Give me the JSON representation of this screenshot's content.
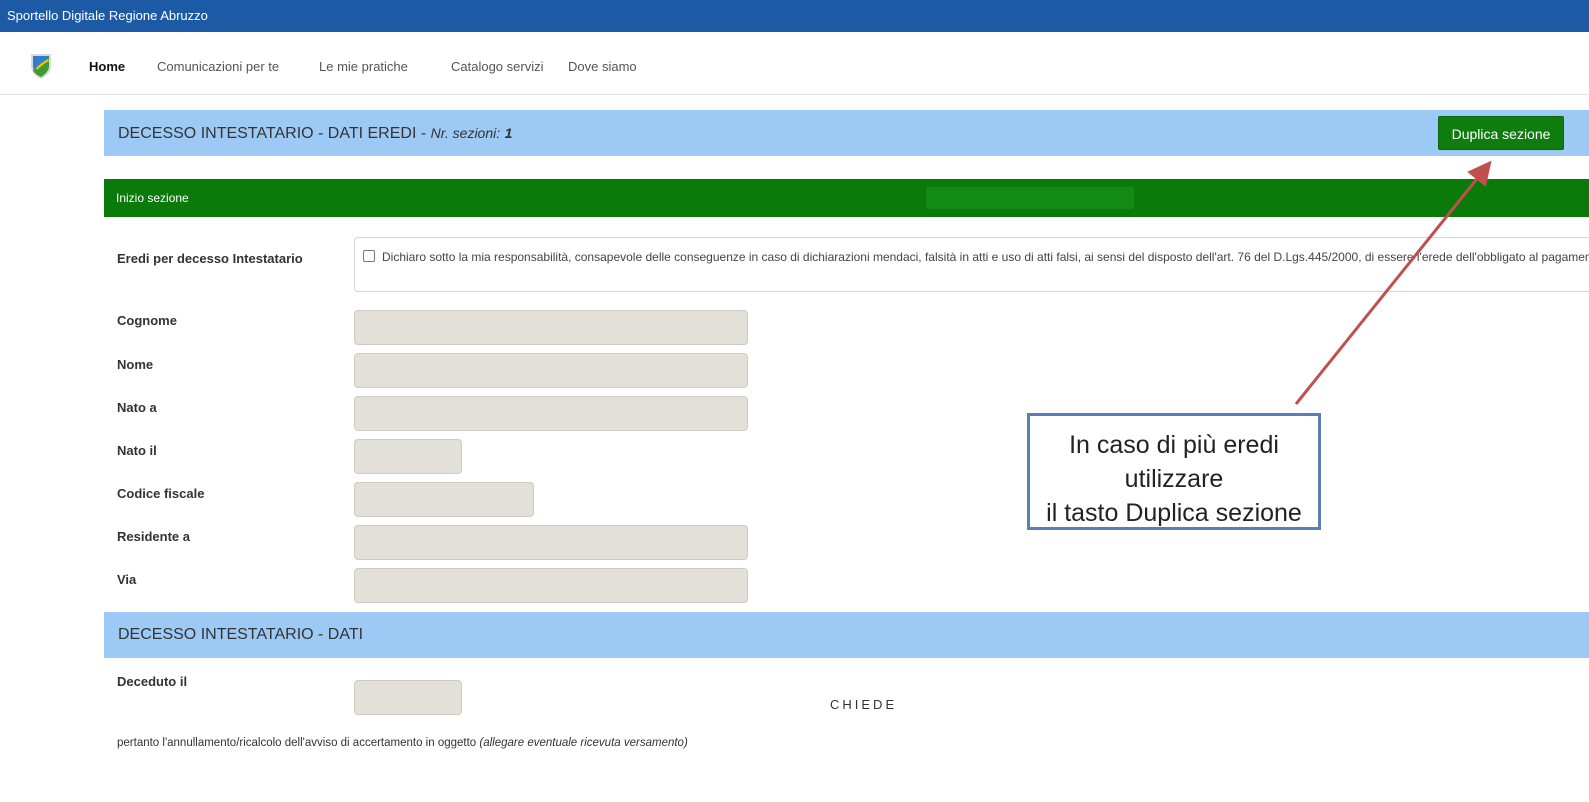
{
  "topbar": {
    "title": "Sportello Digitale Regione Abruzzo"
  },
  "nav": {
    "items": [
      {
        "label": "Home",
        "active": true
      },
      {
        "label": "Comunicazioni per te"
      },
      {
        "label": "Le mie pratiche"
      },
      {
        "label": "Catalogo servizi"
      },
      {
        "label": "Dove siamo"
      }
    ]
  },
  "section_heirs": {
    "title": "DECESSO INTESTATARIO - DATI EREDI -",
    "subtitle": "Nr. sezioni:",
    "count": "1",
    "duplicate_button": "Duplica sezione",
    "start_label": "Inizio sezione"
  },
  "form": {
    "heirs_label": "Eredi per decesso Intestatario",
    "declaration": "Dichiaro sotto la mia responsabilità, consapevole delle conseguenze in caso di dichiarazioni mendaci, falsità in atti e uso di atti falsi, ai sensi del disposto dell'art. 76 del D.Lgs.445/2000, di essere l'erede dell'obbligato al pagamento",
    "fields": [
      {
        "label": "Cognome"
      },
      {
        "label": "Nome"
      },
      {
        "label": "Nato a"
      },
      {
        "label": "Nato il"
      },
      {
        "label": "Codice fiscale"
      },
      {
        "label": "Residente a"
      },
      {
        "label": "Via"
      }
    ]
  },
  "section_data": {
    "title": "DECESSO INTESTATARIO - DATI",
    "deceased_label": "Deceduto il"
  },
  "chiede": "CHIEDE",
  "request": {
    "text": "pertanto l'annullamento/ricalcolo dell'avviso di accertamento in oggetto ",
    "note": "(allegare eventuale ricevuta versamento)"
  },
  "callout": {
    "line1": "In caso di più eredi utilizzare",
    "line2": "il tasto Duplica sezione"
  },
  "colors": {
    "topbar": "#1d5aa5",
    "section_header": "#9dcaf5",
    "green": "#0a7a0a",
    "arrow": "#c0504d",
    "callout_border": "#5b7fb5"
  }
}
